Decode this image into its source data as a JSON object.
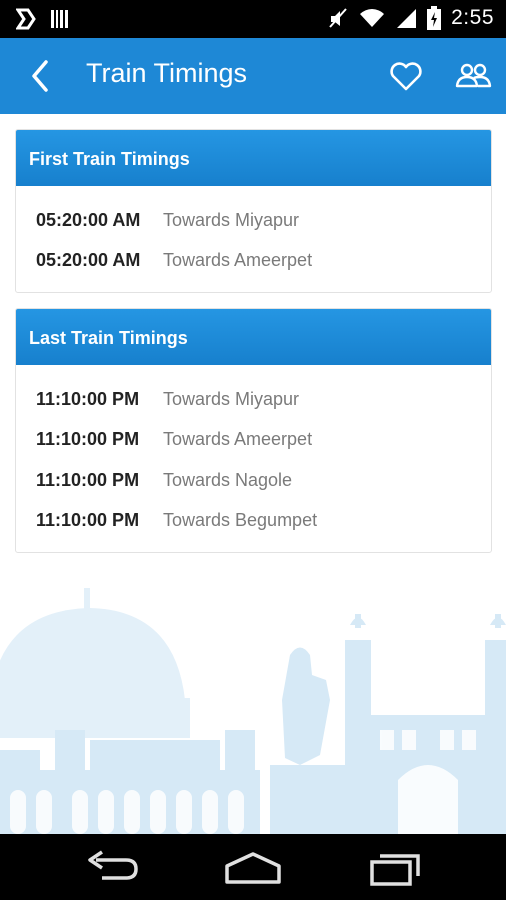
{
  "status_bar": {
    "time": "2:55",
    "icons": [
      "notification-flag-icon",
      "barcode-icon",
      "mute-icon",
      "wifi-icon",
      "signal-icon",
      "battery-icon"
    ]
  },
  "app_bar": {
    "title": "Train Timings",
    "icons": [
      "back-icon",
      "heart-icon",
      "people-icon"
    ],
    "background": "#1e88d6"
  },
  "first_train": {
    "header": "First Train Timings",
    "rows": [
      {
        "time": "05:20:00 AM",
        "destination": "Towards Miyapur"
      },
      {
        "time": "05:20:00 AM",
        "destination": "Towards Ameerpet"
      }
    ]
  },
  "last_train": {
    "header": "Last Train Timings",
    "rows": [
      {
        "time": "11:10:00 PM",
        "destination": "Towards Miyapur"
      },
      {
        "time": "11:10:00 PM",
        "destination": "Towards Ameerpet"
      },
      {
        "time": "11:10:00 PM",
        "destination": "Towards Nagole"
      },
      {
        "time": "11:10:00 PM",
        "destination": "Towards Begumpet"
      }
    ]
  },
  "nav_bar": {
    "icons": [
      "nav-back-icon",
      "home-icon",
      "recents-icon"
    ]
  },
  "colors": {
    "accent": "#1e88d6",
    "skyline": "#d9ebf7"
  }
}
